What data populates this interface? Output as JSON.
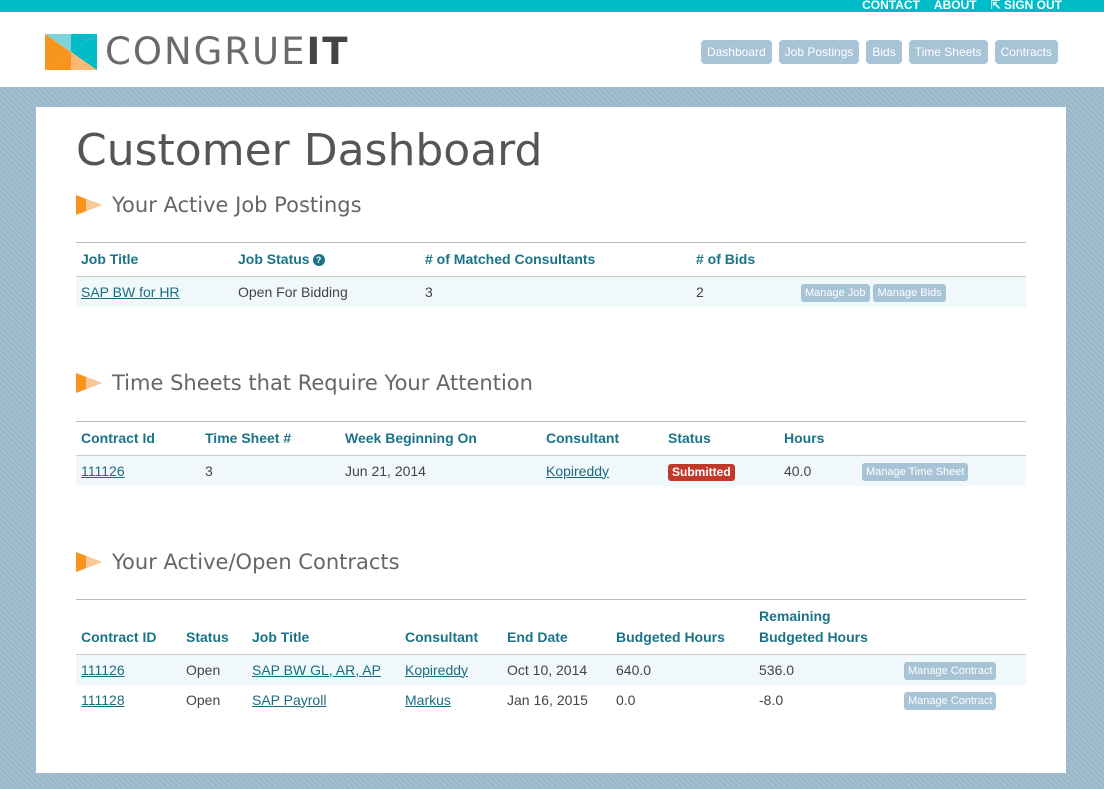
{
  "top_links": {
    "contact": "CONTACT",
    "about": "ABOUT",
    "sign_out": "SIGN OUT"
  },
  "logo": {
    "text_a": "CONGRUE",
    "text_b": "IT"
  },
  "nav": [
    "Dashboard",
    "Job Postings",
    "Bids",
    "Time Sheets",
    "Contracts"
  ],
  "page_title": "Customer Dashboard",
  "jobs": {
    "heading": "Your Active Job Postings",
    "headers": [
      "Job Title",
      "Job Status",
      "# of Matched Consultants",
      "# of Bids"
    ],
    "rows": [
      {
        "title": "SAP BW for HR",
        "status": "Open For Bidding",
        "matched": "3",
        "bids": "2",
        "btn1": "Manage Job",
        "btn2": "Manage Bids"
      }
    ]
  },
  "timesheets": {
    "heading": "Time Sheets that Require Your Attention",
    "headers": [
      "Contract Id",
      "Time Sheet #",
      "Week Beginning On",
      "Consultant",
      "Status",
      "Hours"
    ],
    "rows": [
      {
        "contract": "111126",
        "sheet": "3",
        "week": "Jun 21, 2014",
        "consultant": "Kopireddy",
        "status": "Submitted",
        "hours": "40.0",
        "btn": "Manage Time Sheet"
      }
    ]
  },
  "contracts": {
    "heading": "Your Active/Open Contracts",
    "headers": [
      "Contract ID",
      "Status",
      "Job Title",
      "Consultant",
      "End Date",
      "Budgeted Hours",
      "Remaining",
      "Budgeted Hours"
    ],
    "rows": [
      {
        "id": "111126",
        "status": "Open",
        "title": "SAP BW GL, AR, AP",
        "consultant": "Kopireddy",
        "end": "Oct 10, 2014",
        "budgeted": "640.0",
        "remaining": "536.0",
        "btn": "Manage Contract"
      },
      {
        "id": "111128",
        "status": "Open",
        "title": "SAP Payroll",
        "consultant": "Markus",
        "end": "Jan 16, 2015",
        "budgeted": "0.0",
        "remaining": "-8.0",
        "btn": "Manage Contract"
      }
    ]
  },
  "colors": {
    "accent": "#00bcc8",
    "header_text": "#1a7387",
    "badge": "#c0392b",
    "button": "#a7c3d6"
  }
}
